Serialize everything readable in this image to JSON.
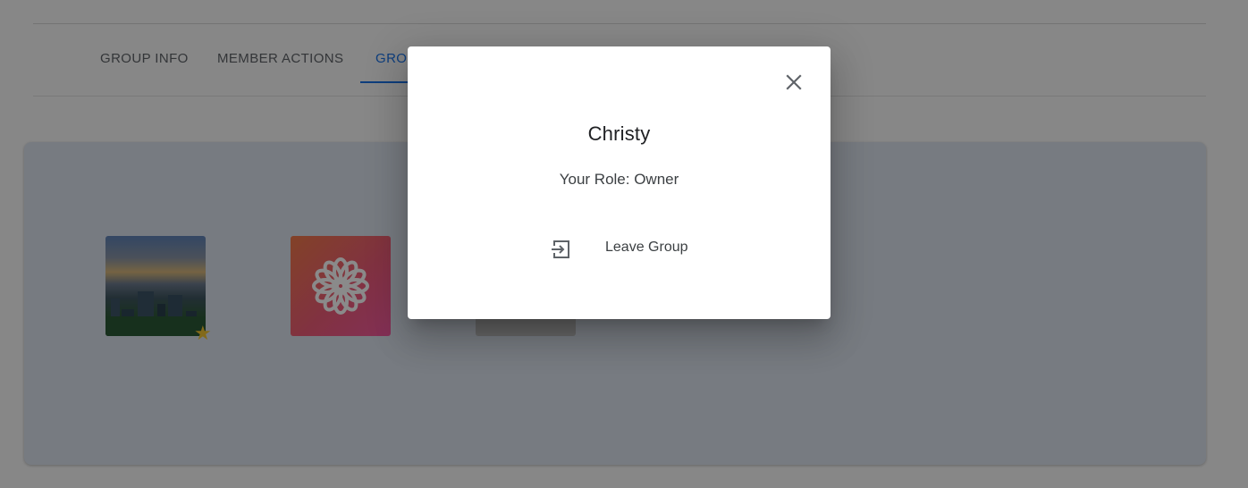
{
  "tabs": [
    {
      "label": "GROUP INFO"
    },
    {
      "label": "MEMBER ACTIONS"
    },
    {
      "label": "GROUP"
    }
  ],
  "icons": {
    "close": "close-icon",
    "leave": "exit-to-app-icon",
    "favorite": "star-icon",
    "flower": "flower-icon"
  },
  "colors": {
    "accent": "#1a73e8",
    "star": "#f2c530",
    "card_background": "#dde3ef"
  },
  "dialog": {
    "title": "Christy",
    "role_text": "Your Role: Owner",
    "leave_label": "Leave Group"
  }
}
